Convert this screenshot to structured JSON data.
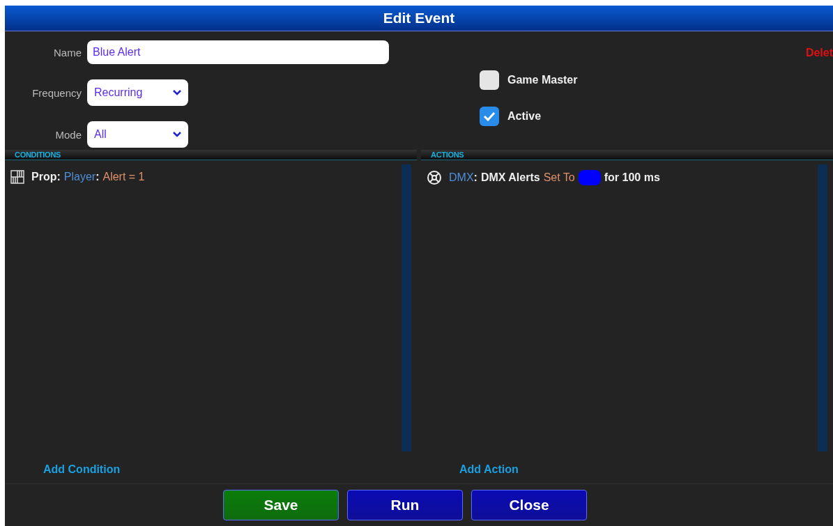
{
  "window": {
    "title": "Edit Event"
  },
  "delete_link": "Delet",
  "fields": [
    {
      "label": "Name",
      "kind": "text",
      "value": "Blue Alert"
    },
    {
      "label": "Frequency",
      "kind": "select",
      "value": "Recurring"
    },
    {
      "label": "Mode",
      "kind": "select",
      "value": "All"
    }
  ],
  "checkboxes": [
    {
      "label": "Game Master",
      "checked": false
    },
    {
      "label": "Active",
      "checked": true
    }
  ],
  "conditions": {
    "heading": "CONDITIONS",
    "items": [
      {
        "segments": [
          {
            "kind": "type",
            "text": "Prop:"
          },
          {
            "kind": "ref",
            "text": "Player"
          },
          {
            "kind": "sep",
            "text": ":"
          },
          {
            "kind": "op",
            "text": "Alert = 1"
          }
        ]
      }
    ],
    "add_link": "Add Condition"
  },
  "actions": {
    "heading": "ACTIONS",
    "items": [
      {
        "segments": [
          {
            "kind": "ref",
            "text": "DMX"
          },
          {
            "kind": "sep",
            "text": ":"
          },
          {
            "kind": "plain",
            "text": "DMX Alerts"
          },
          {
            "kind": "op",
            "text": "Set To"
          },
          {
            "kind": "swatch",
            "color": "#0000ff"
          },
          {
            "kind": "plain",
            "text": "for 100 ms"
          }
        ]
      }
    ],
    "add_link": "Add Action"
  },
  "buttons": [
    {
      "label": "Save",
      "color": "#0a7d0a"
    },
    {
      "label": "Run",
      "color": "#0a0ab4"
    },
    {
      "label": "Close",
      "color": "#0a0ab4"
    }
  ]
}
